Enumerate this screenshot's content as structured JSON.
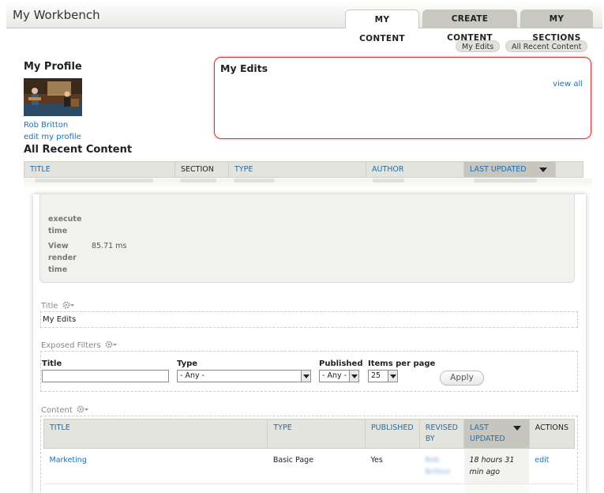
{
  "header": {
    "site_title": "My Workbench",
    "tabs": [
      {
        "label": "MY CONTENT",
        "active": true
      },
      {
        "label": "CREATE CONTENT",
        "active": false
      },
      {
        "label": "MY SECTIONS",
        "active": false
      }
    ]
  },
  "sub_tabs": [
    "My Edits",
    "All Recent Content"
  ],
  "profile": {
    "heading": "My Profile",
    "name": "Rob Britton",
    "edit_link": "edit my profile"
  },
  "my_edits_block": {
    "heading": "My Edits",
    "view_all": "view all"
  },
  "all_recent": {
    "heading": "All Recent Content",
    "columns": [
      "TITLE",
      "SECTION",
      "TYPE",
      "AUTHOR",
      "LAST UPDATED"
    ]
  },
  "views_stats": {
    "execute_label": "execute time",
    "render_label": "View render time",
    "render_value": "85.71 ms"
  },
  "title_section": {
    "label": "Title",
    "value": "My Edits"
  },
  "exposed_filters": {
    "label": "Exposed Filters",
    "title_label": "Title",
    "title_value": "",
    "type_label": "Type",
    "type_value": "- Any -",
    "published_label": "Published",
    "published_value": "- Any -",
    "items_label": "Items per page",
    "items_value": "25",
    "apply_label": "Apply"
  },
  "content_section": {
    "label": "Content",
    "columns": [
      "TITLE",
      "TYPE",
      "PUBLISHED",
      "REVISED BY",
      "LAST UPDATED",
      "ACTIONS"
    ],
    "rows": [
      {
        "title": "Marketing",
        "type": "Basic Page",
        "published": "Yes",
        "revised_by": "Rob Britton",
        "last_updated": "18 hours 31 min ago",
        "action": "edit"
      },
      {
        "title": "",
        "type": "",
        "published": "",
        "revised_by": "",
        "last_updated": "",
        "action": ""
      }
    ]
  },
  "colors": {
    "link": "#1f6fb2",
    "highlight_border": "#dd3333",
    "tab_inactive": "#c8c8c1",
    "header_gray": "#e4e4de"
  }
}
